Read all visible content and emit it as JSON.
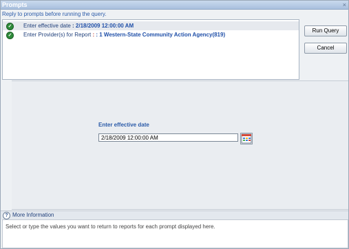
{
  "window": {
    "title": "Prompts",
    "close_glyph": "×"
  },
  "instruction": "Reply to prompts before running the query.",
  "prompts": [
    {
      "label": "Enter effective date",
      "separator": " : ",
      "value": "2/18/2009 12:00:00 AM",
      "status_icon": "check-icon"
    },
    {
      "label": "Enter Provider(s) for Report",
      "separator": " : ",
      "value": ": 1 Western-State Community Action Agency(819)",
      "status_icon": "check-icon"
    }
  ],
  "buttons": {
    "run_query": "Run Query",
    "cancel": "Cancel"
  },
  "editor": {
    "label": "Enter effective date",
    "value": "2/18/2009 12:00:00 AM",
    "calendar_icon": "calendar-icon"
  },
  "more_info": {
    "label": "More Information",
    "icon": "help-icon"
  },
  "help_text": "Select or type the values you want to return to reports for each prompt displayed here.",
  "colors": {
    "accent": "#2a5aa8",
    "check": "#2e8b3a"
  }
}
